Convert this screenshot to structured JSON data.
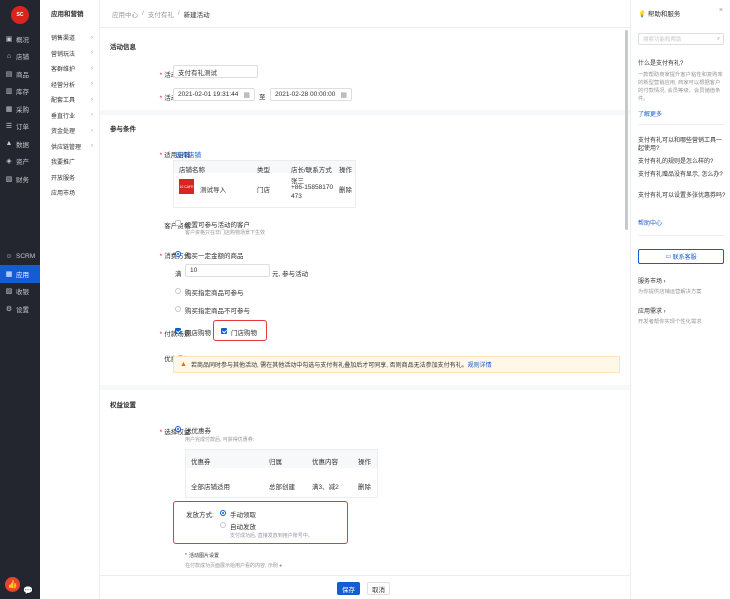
{
  "app": {
    "logo_text": "SC"
  },
  "sidebar": {
    "items": [
      {
        "label": "概况",
        "icon": "dashboard-icon"
      },
      {
        "label": "店铺",
        "icon": "store-icon"
      },
      {
        "label": "商品",
        "icon": "goods-icon"
      },
      {
        "label": "库存",
        "icon": "inventory-icon"
      },
      {
        "label": "采购",
        "icon": "purchase-icon"
      },
      {
        "label": "订单",
        "icon": "order-icon"
      },
      {
        "label": "数据",
        "icon": "data-icon"
      },
      {
        "label": "资产",
        "icon": "asset-icon"
      },
      {
        "label": "财务",
        "icon": "finance-icon"
      }
    ],
    "items2": [
      {
        "label": "SCRM",
        "icon": "scrm-icon"
      },
      {
        "label": "应用",
        "icon": "apps-icon"
      },
      {
        "label": "收银",
        "icon": "cashier-icon"
      },
      {
        "label": "设置",
        "icon": "settings-icon"
      }
    ]
  },
  "subnav": {
    "title": "应用和营销",
    "items": [
      {
        "label": "销售渠道",
        "arrow": true
      },
      {
        "label": "营销玩法",
        "arrow": true
      },
      {
        "label": "客群维护",
        "arrow": true
      },
      {
        "label": "经营分析",
        "arrow": true
      },
      {
        "label": "配套工具",
        "arrow": true
      },
      {
        "label": "垂直行业",
        "arrow": true
      },
      {
        "label": "资金处理",
        "arrow": true
      },
      {
        "label": "供应链管理",
        "arrow": true
      },
      {
        "label": "我要推广",
        "arrow": false
      },
      {
        "label": "开放服务",
        "arrow": false
      },
      {
        "label": "应用市场",
        "arrow": false
      }
    ]
  },
  "breadcrumb": {
    "items": [
      "应用中心",
      "支付有礼",
      "新建活动"
    ]
  },
  "form": {
    "section_info": "活动信息",
    "name_label": "活动名称:",
    "name_value": "支付有礼测试",
    "time_label": "活动时间:",
    "start_time": "2021-02-01 19:31:44",
    "to": "至",
    "end_time": "2021-02-28 00:00:00",
    "section_cond": "参与条件",
    "store_label": "适用店铺:",
    "store_select": "选择店铺",
    "store_table": {
      "headers": [
        "店铺名称",
        "类型",
        "店长/联系方式",
        "操作"
      ],
      "row": {
        "thumb_text": "10 CAFE",
        "name": "测试导入",
        "type": "门店",
        "contact_name": "张三",
        "phone1": "+86-15858170",
        "phone2": "473",
        "action": "删除"
      }
    },
    "qual_label": "客户资格:",
    "qual_option": "设置可参与活动的客户",
    "qual_hint": "客户资格只在非门店购物场景下生效",
    "consume_label": "消费方式:",
    "consume_opt1": "购买一定金额的商品",
    "amount_prefix": "满",
    "amount_value": "10",
    "amount_suffix": "元, 参与活动",
    "consume_opt2": "购买指定商品可参与",
    "consume_opt3": "购买指定商品不可参与",
    "scene_label": "付款场景:",
    "scene_online": "网店购物",
    "scene_store": "门店购物",
    "stack_label": "优惠叠加:",
    "stack_warning": "若商品同时参与其他活动, 需在其他活动中勾选与支付有礼叠加后才可同享, 否则商品无法参加支付有礼。",
    "stack_link": "规则详情",
    "section_rights": "权益设置",
    "rights_label": "选择权益:",
    "rights_option": "送优惠券",
    "rights_hint": "用户完成付款后, 可获得优惠券:",
    "coupon_table": {
      "headers": [
        "优惠券",
        "归属",
        "优惠内容",
        "操作"
      ],
      "row": {
        "name": "全部店铺适用",
        "owner": "总部创建",
        "content": "满3、减2",
        "action": "删除"
      }
    },
    "issue_label": "发放方式:",
    "issue_manual": "手动领取",
    "issue_auto": "自动发放",
    "issue_hint": "支付成功后, 直接发放到用户账号中。",
    "image_label": "活动图片设置",
    "image_hint": "在付款成功页面展示给用户看的内容, 示例"
  },
  "footer": {
    "save": "保存",
    "cancel": "取消"
  },
  "help": {
    "title": "帮助和服务",
    "search_placeholder": "搜索功能和帮助",
    "q1": "什么是支付有礼?",
    "d1": "一款帮助商家提升客户粘性和复购率的新型营销应用, 商家可以根据客户的付款情况, 会员等级、会员储值条件。",
    "more": "了解更多",
    "q2": "支付有礼可以和哪些营销工具一起使用?",
    "q3": "支付有礼的规则是怎么样的?",
    "q4": "支付有礼赠品没有显示, 怎么办?",
    "q5": "支付有礼可以设置多张优惠券吗?",
    "center": "帮助中心",
    "contact": "联系客服",
    "market": "服务市场 ›",
    "market_desc": "为你提供店铺运营解决方案",
    "need": "应用需求 ›",
    "need_desc": "开发者帮你实现个性化需求"
  }
}
